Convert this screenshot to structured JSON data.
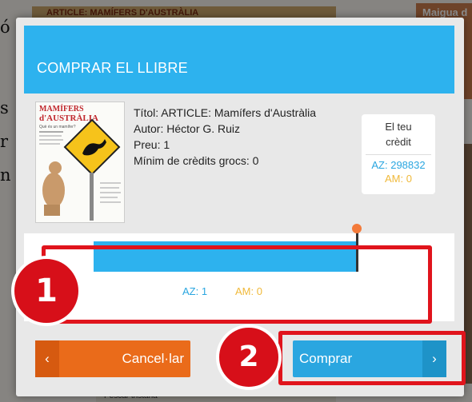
{
  "background": {
    "header_title": "ARTICLE: MAMÍFERS D'AUSTRÀLIA",
    "right_label": "Maigua d",
    "left_fragments": [
      "ó",
      "s",
      "r",
      "n"
    ],
    "bottom_label": "Pescar tristana"
  },
  "modal": {
    "title": "COMPRAR EL LLIBRE",
    "cover": {
      "title_line1": "MAMÍFERS",
      "title_line2": "d'AUSTRÀLIA",
      "subtitle": "Què és un mamífer?"
    },
    "info": {
      "title": "Títol: ARTICLE: Mamífers d'Austràlia",
      "author": "Autor: Héctor G. Ruiz",
      "price": "Preu: 1",
      "min_credits": "Mínim de crèdits grocs: 0"
    },
    "credit": {
      "label_line1": "El teu",
      "label_line2": "crèdit",
      "az": "AZ: 298832",
      "am": "AM: 0"
    },
    "selection": {
      "slider_fill_fraction": 1.0,
      "az": "AZ: 1",
      "am": "AM: 0"
    },
    "buttons": {
      "cancel": "Cancel·lar",
      "buy": "Comprar",
      "cancel_chevron": "‹",
      "buy_chevron": "›"
    },
    "annotations": {
      "badge1": "1",
      "badge2": "2"
    }
  },
  "colors": {
    "header": "#2db2ee",
    "cancel": "#ea6b1a",
    "buy": "#2aa6e0",
    "annotation_red": "#e0141c",
    "az_blue": "#2aa6e0",
    "am_yellow": "#f0b93a"
  }
}
